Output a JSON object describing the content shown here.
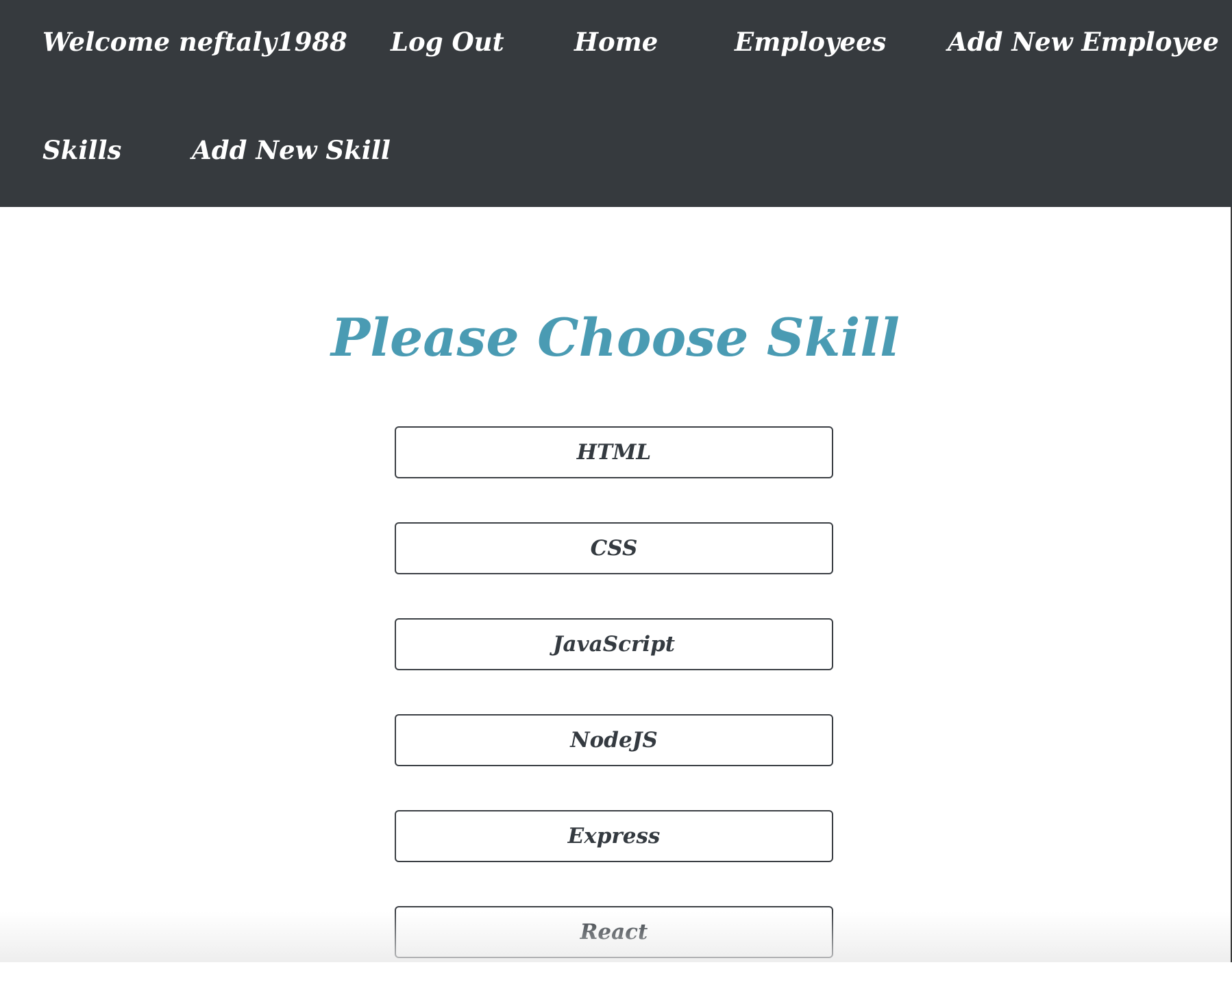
{
  "nav": {
    "welcome": "Welcome neftaly1988",
    "logout": "Log Out",
    "home": "Home",
    "employees": "Employees",
    "add_employee": "Add New Employee",
    "skills": "Skills",
    "add_skill": "Add New Skill"
  },
  "main": {
    "title": "Please Choose Skill",
    "skills": [
      "HTML",
      "CSS",
      "JavaScript",
      "NodeJS",
      "Express",
      "React"
    ]
  },
  "colors": {
    "navbar_bg": "#363a3e",
    "title": "#4a9bb3",
    "button_border": "#3b3f44"
  }
}
